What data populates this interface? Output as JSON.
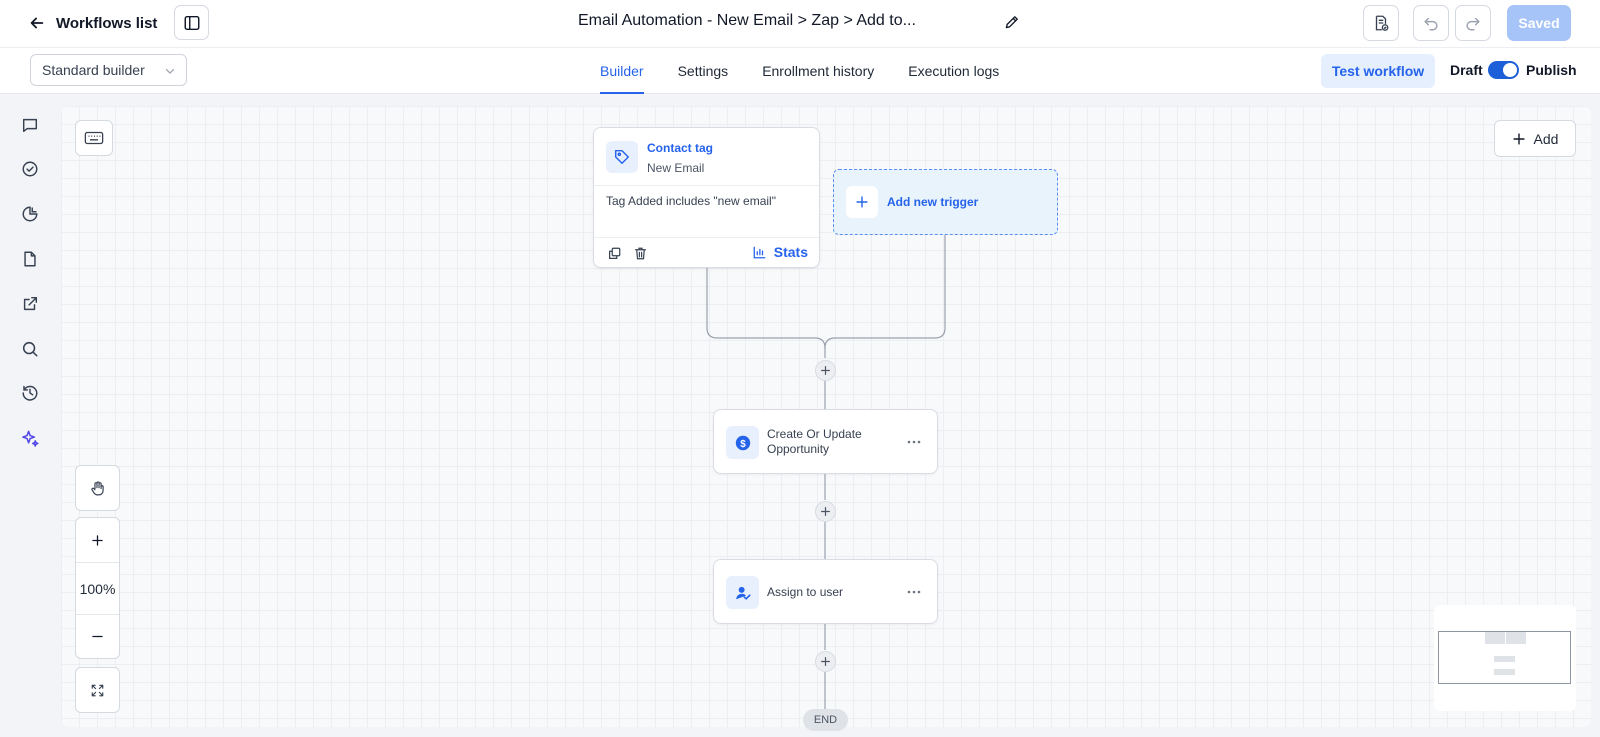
{
  "topbar": {
    "back_label": "Workflows list",
    "title": "Email Automation - New Email > Zap > Add to...",
    "saved_label": "Saved"
  },
  "subbar": {
    "builder_select": "Standard builder",
    "tabs": [
      {
        "label": "Builder",
        "active": true
      },
      {
        "label": "Settings",
        "active": false
      },
      {
        "label": "Enrollment history",
        "active": false
      },
      {
        "label": "Execution logs",
        "active": false
      }
    ],
    "test_label": "Test workflow",
    "draft_label": "Draft",
    "publish_label": "Publish",
    "publish_toggle_on": true
  },
  "rail": {
    "icons": [
      "chat-icon",
      "check-circle-icon",
      "pie-chart-icon",
      "document-icon",
      "external-link-icon",
      "search-icon",
      "history-icon",
      "sparkle-icon"
    ]
  },
  "canvas": {
    "add_label": "Add",
    "zoom_level": "100%",
    "trigger": {
      "title": "Contact tag",
      "subtitle": "New Email",
      "filter": "Tag Added includes \"new email\"",
      "stats_label": "Stats"
    },
    "new_trigger_label": "Add new trigger",
    "actions": [
      {
        "label": "Create Or Update Opportunity",
        "icon": "dollar-icon"
      },
      {
        "label": "Assign to user",
        "icon": "user-assign-icon"
      }
    ],
    "end_label": "END"
  },
  "colors": {
    "accent": "#2563eb",
    "saved_disabled": "#a7c4f8",
    "sparkle": "#4f46e5"
  }
}
